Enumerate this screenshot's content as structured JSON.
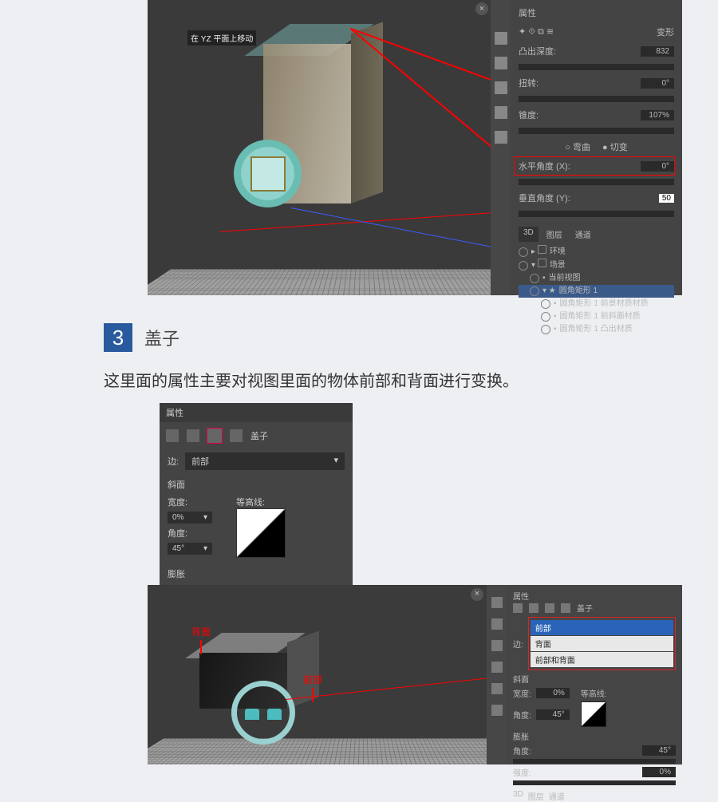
{
  "section": {
    "number": "3",
    "title": "盖子"
  },
  "paragraph": "这里面的属性主要对视图里面的物体前部和背面进行变换。",
  "shot1": {
    "gizmo_label": "在 YZ 平面上移动",
    "panel_title": "属性",
    "mode_label": "变形",
    "extrude_label": "凸出深度:",
    "extrude_value": "832",
    "twist_label": "扭转:",
    "twist_value": "0°",
    "taper_label": "锥度:",
    "taper_value": "107%",
    "bend_label": "弯曲",
    "shear_label": "切变",
    "hangle_label": "水平角度 (X):",
    "hangle_value": "0°",
    "vangle_label": "垂直角度 (Y):",
    "vangle_value": "50",
    "tab_3d": "3D",
    "tab_layers": "图层",
    "tab_channels": "通道",
    "tree": {
      "env": "环境",
      "scene": "场景",
      "curview": "当前视图",
      "shape": "圆角矩形 1",
      "mat_front": "圆角矩形 1 前景材质材质",
      "mat_bevel": "圆角矩形 1 前斜面材质",
      "mat_extr": "圆角矩形 1 凸出材质"
    }
  },
  "shot2": {
    "title": "属性",
    "cap_label": "盖子",
    "side_label": "边:",
    "side_value": "前部",
    "bevel_title": "斜面",
    "width_label": "宽度:",
    "width_value": "0%",
    "angle_label": "角度:",
    "angle_value": "45°",
    "contour_label": "等高线:",
    "inflate_title": "膨胀"
  },
  "shot3": {
    "label_back": "背面",
    "label_front": "前部",
    "panel_title": "属性",
    "cap_label": "盖子",
    "side_label": "边:",
    "dd_front": "前部",
    "dd_back": "背面",
    "dd_both": "前部和背面",
    "bevel_title": "斜面",
    "width_label": "宽度:",
    "width_value": "0%",
    "angle_label": "角度:",
    "angle_value": "45°",
    "contour_label": "等高线:",
    "inflate_title": "膨胀",
    "inf_angle_label": "角度:",
    "inf_angle_value": "45°",
    "inf_str_label": "强度:",
    "inf_str_value": "0%",
    "tab_3d": "3D",
    "tab_layers": "图层",
    "tab_channels": "通道"
  }
}
